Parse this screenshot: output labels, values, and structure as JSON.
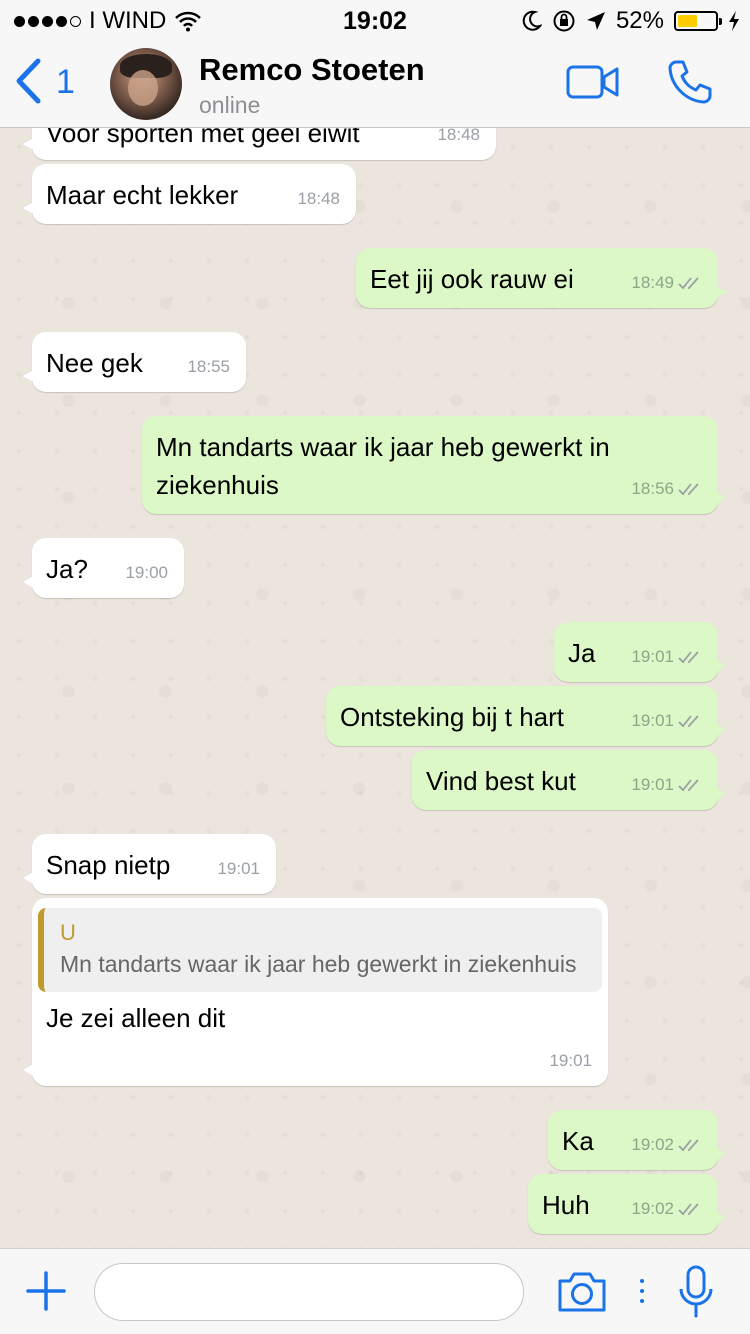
{
  "status_bar": {
    "carrier": "I WIND",
    "time": "19:02",
    "battery": "52%",
    "battery_level": 0.52
  },
  "header": {
    "back_count": "1",
    "contact_name": "Remco Stoeten",
    "contact_status": "online"
  },
  "messages": [
    {
      "dir": "in",
      "text": "Voor sporten met geel eiwit",
      "time": "18:48"
    },
    {
      "dir": "in",
      "text": "Maar echt lekker",
      "time": "18:48"
    },
    {
      "dir": "out",
      "text": "Eet jij ook rauw ei",
      "time": "18:49"
    },
    {
      "dir": "in",
      "text": "Nee gek",
      "time": "18:55"
    },
    {
      "dir": "out",
      "text": "Mn tandarts waar ik jaar heb gewerkt in ziekenhuis",
      "time": "18:56"
    },
    {
      "dir": "in",
      "text": "Ja?",
      "time": "19:00"
    },
    {
      "dir": "out",
      "text": "Ja",
      "time": "19:01"
    },
    {
      "dir": "out",
      "text": "Ontsteking bij t hart",
      "time": "19:01"
    },
    {
      "dir": "out",
      "text": "Vind best kut",
      "time": "19:01"
    },
    {
      "dir": "in",
      "text": "Snap nietp",
      "time": "19:01"
    },
    {
      "dir": "in",
      "text": "Je zei alleen dit",
      "time": "19:01",
      "quote": {
        "author": "U",
        "text": "Mn tandarts waar ik jaar heb gewerkt in ziekenhuis"
      }
    },
    {
      "dir": "out",
      "text": "Ka",
      "time": "19:02"
    },
    {
      "dir": "out",
      "text": "Huh",
      "time": "19:02"
    }
  ],
  "colors": {
    "accent": "#1a73e8",
    "outgoing_bubble": "#dcf8c6",
    "incoming_bubble": "#ffffff",
    "quote_accent": "#c09a2f",
    "chat_background": "#ece5dd"
  },
  "icons": {
    "back": "chevron-left-icon",
    "video": "video-camera-icon",
    "call": "phone-icon",
    "attach": "plus-icon",
    "camera": "camera-icon",
    "mic": "microphone-icon",
    "read_receipt": "double-check-icon"
  },
  "composer": {
    "value": "",
    "placeholder": ""
  }
}
